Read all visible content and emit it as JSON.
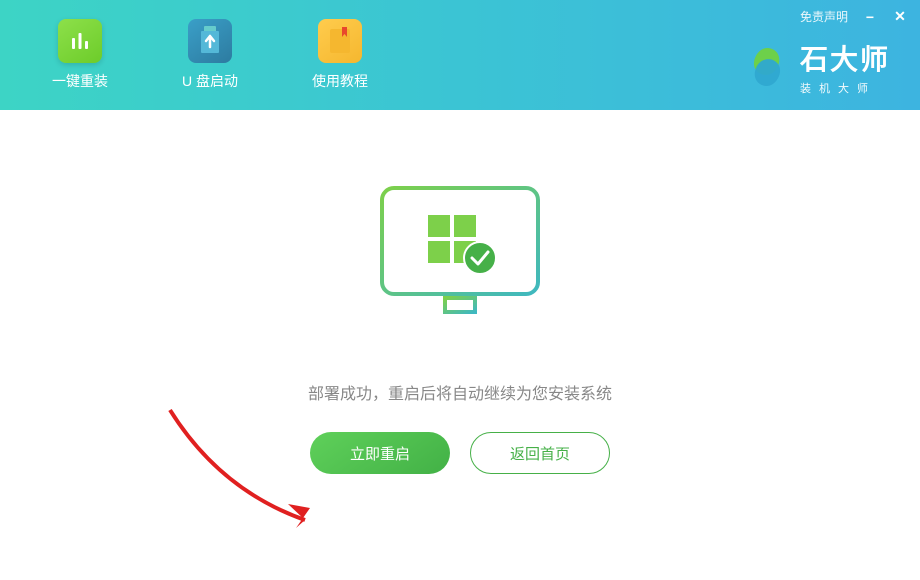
{
  "header": {
    "disclaimer": "免责声明",
    "nav": [
      {
        "label": "一键重装",
        "active": true
      },
      {
        "label": "U 盘启动",
        "active": false
      },
      {
        "label": "使用教程",
        "active": false
      }
    ],
    "brand": {
      "name": "石大师",
      "subtitle": "装机大师"
    }
  },
  "main": {
    "status_text": "部署成功，重启后将自动继续为您安装系统",
    "restart_label": "立即重启",
    "home_label": "返回首页"
  },
  "colors": {
    "primary_green": "#46b048",
    "header_gradient_start": "#3dd4c5",
    "header_gradient_end": "#3db4e0"
  }
}
